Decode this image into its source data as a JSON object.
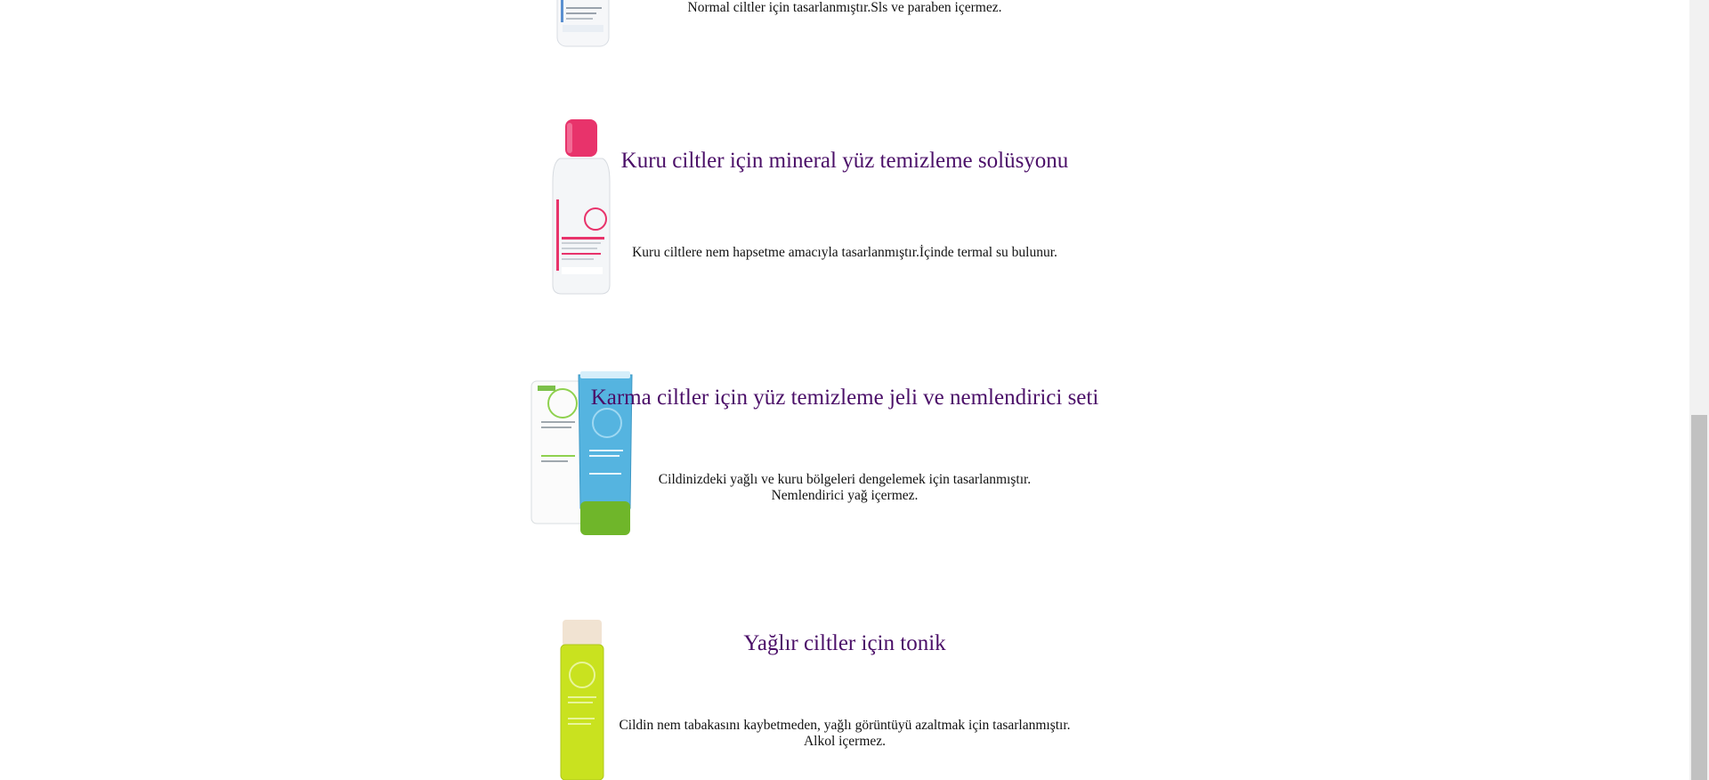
{
  "products": [
    {
      "title": "",
      "description": "Normal ciltler için tasarlanmıştır.Sls ve paraben içermez.",
      "image": "micellar-water-bottle"
    },
    {
      "title": "Kuru ciltler için mineral yüz temizleme solüsyonu",
      "description": "Kuru ciltlere nem hapsetme amacıyla tasarlanmıştır.İçinde termal su bulunur.",
      "image": "pink-cap-micellar-bottle"
    },
    {
      "title": "Karma ciltler için yüz temizleme jeli ve nemlendirici seti",
      "description_line1": "Cildinizdeki yağlı ve kuru bölgeleri dengelemek için tasarlanmıştır.",
      "description_line2": "Nemlendirici yağ içermez.",
      "image": "sebium-tube-set"
    },
    {
      "title": "Yağlır ciltler için tonik",
      "description_line1": "Cildin nem tabakasını kaybetmeden, yağlı görüntüyü azaltmak için tasarlanmıştır.",
      "description_line2": "Alkol içermez.",
      "image": "green-toner-bottle"
    }
  ],
  "colors": {
    "title": "#4b0f68",
    "text": "#111111",
    "scrollbar_track": "#f1f1f1",
    "scrollbar_thumb": "#c1c1c1"
  }
}
